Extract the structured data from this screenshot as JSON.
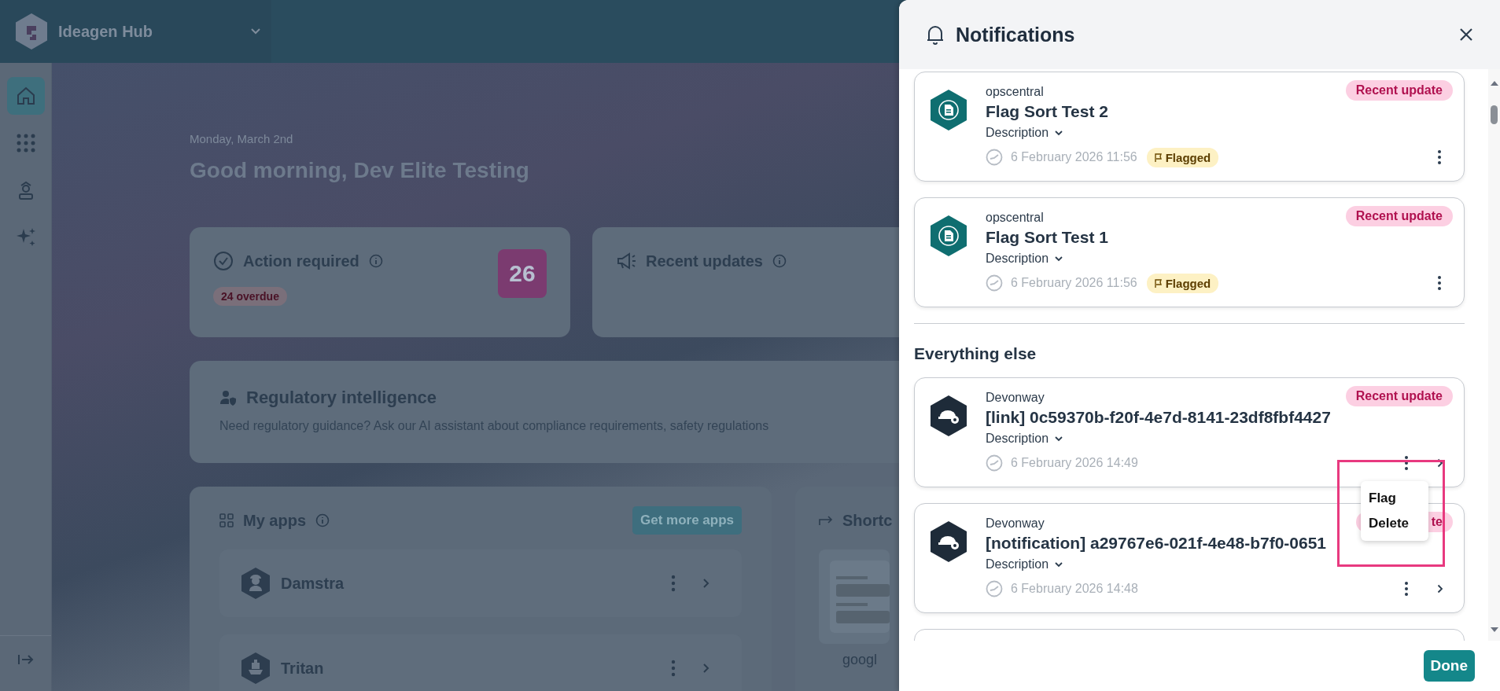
{
  "app": {
    "name": "Ideagen Hub"
  },
  "nav": [
    {
      "kind": "home",
      "selected": true
    },
    {
      "kind": "apps",
      "selected": false
    },
    {
      "kind": "person",
      "selected": false
    },
    {
      "kind": "sparkle",
      "selected": false
    }
  ],
  "home": {
    "date": "Monday, March 2nd",
    "greeting": "Good morning, Dev Elite Testing"
  },
  "summary_cards": [
    {
      "kind": "action",
      "title": "Action required",
      "count": "26",
      "badge": "24 overdue"
    },
    {
      "kind": "updates",
      "title": "Recent updates"
    }
  ],
  "regulatory": {
    "title": "Regulatory intelligence",
    "text": "Need regulatory guidance? Ask our AI assistant about compliance requirements, safety regulations"
  },
  "my_apps": {
    "title": "My apps",
    "button": "Get more apps",
    "apps": [
      {
        "name": "Damstra",
        "kind": "worker"
      },
      {
        "name": "Tritan",
        "kind": "ship"
      }
    ]
  },
  "shortcuts": {
    "title": "Shortc",
    "items": [
      "googl"
    ]
  },
  "notifications": {
    "title": "Notifications",
    "sections": [
      {
        "items": [
          {
            "kind": "doc",
            "source": "opscentral",
            "title": "Flag Sort Test 2",
            "description": "Description",
            "time": "6 February 2026 11:56",
            "badge": "Recent update",
            "flag_label": "Flagged"
          },
          {
            "kind": "doc",
            "source": "opscentral",
            "title": "Flag Sort Test 1",
            "description": "Description",
            "time": "6 February 2026 11:56",
            "badge": "Recent update",
            "flag_label": "Flagged"
          }
        ]
      },
      {
        "heading": "Everything else",
        "items": [
          {
            "kind": "helmet",
            "source": "Devonway",
            "title": "[link] 0c59370b-f20f-4e7d-8141-23df8fbf4427",
            "description": "Description",
            "time": "6 February 2026 14:49",
            "badge": "Recent update",
            "openable": true,
            "menu_open": true
          },
          {
            "kind": "helmet",
            "source": "Devonway",
            "title": "[notification] a29767e6-021f-4e48-b7f0-0651",
            "description": "Description",
            "time": "6 February 2026 14:48",
            "badge": "te",
            "badge_covered": true,
            "openable": true
          }
        ]
      }
    ],
    "menu": [
      "Flag",
      "Delete"
    ],
    "done": "Done"
  }
}
